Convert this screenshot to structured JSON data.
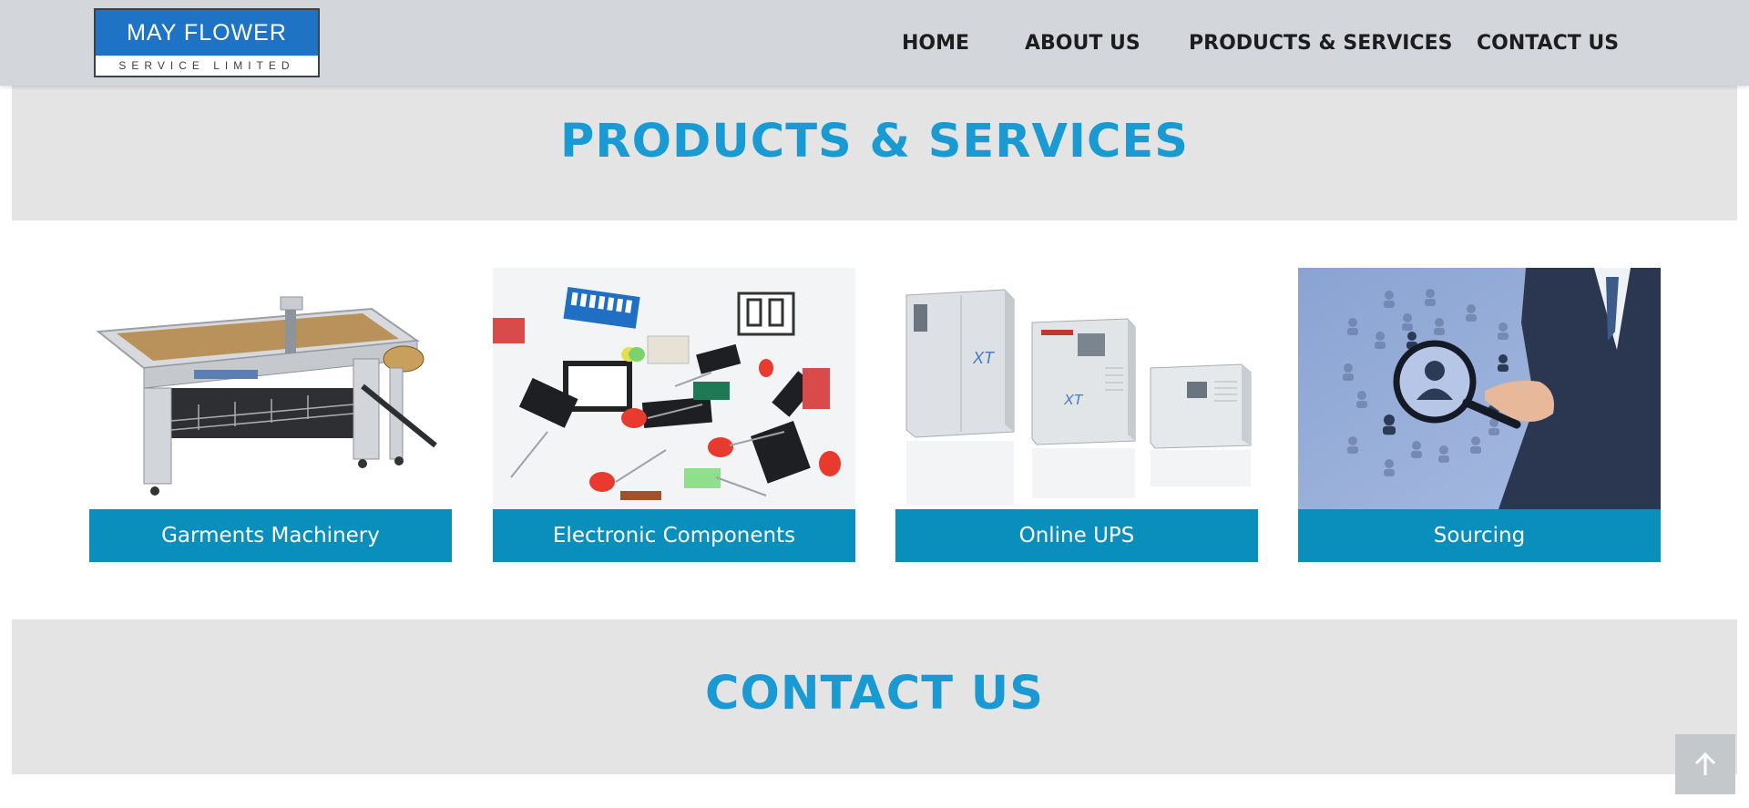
{
  "header": {
    "logo": {
      "line1": "MAY FLOWER",
      "line2": "SERVICE LIMITED"
    },
    "nav": [
      {
        "label": "HOME"
      },
      {
        "label": "ABOUT US"
      },
      {
        "label": "PRODUCTS & SERVICES"
      },
      {
        "label": "CONTACT US"
      }
    ]
  },
  "products_section": {
    "title": "PRODUCTS & SERVICES",
    "items": [
      {
        "label": "Garments Machinery",
        "image": "cutting-plotter-machine-image"
      },
      {
        "label": "Electronic Components",
        "image": "electronic-components-image"
      },
      {
        "label": "Online UPS",
        "image": "ups-units-image"
      },
      {
        "label": "Sourcing",
        "image": "sourcing-magnifier-image"
      }
    ]
  },
  "contact_section": {
    "title": "CONTACT US"
  },
  "scroll_top": {
    "icon": "arrow-up-icon"
  },
  "colors": {
    "header_bg": "#d3d7dc",
    "accent": "#1a9ad3",
    "label_bg": "#0a8fbd",
    "band_bg": "#e4e4e5"
  }
}
